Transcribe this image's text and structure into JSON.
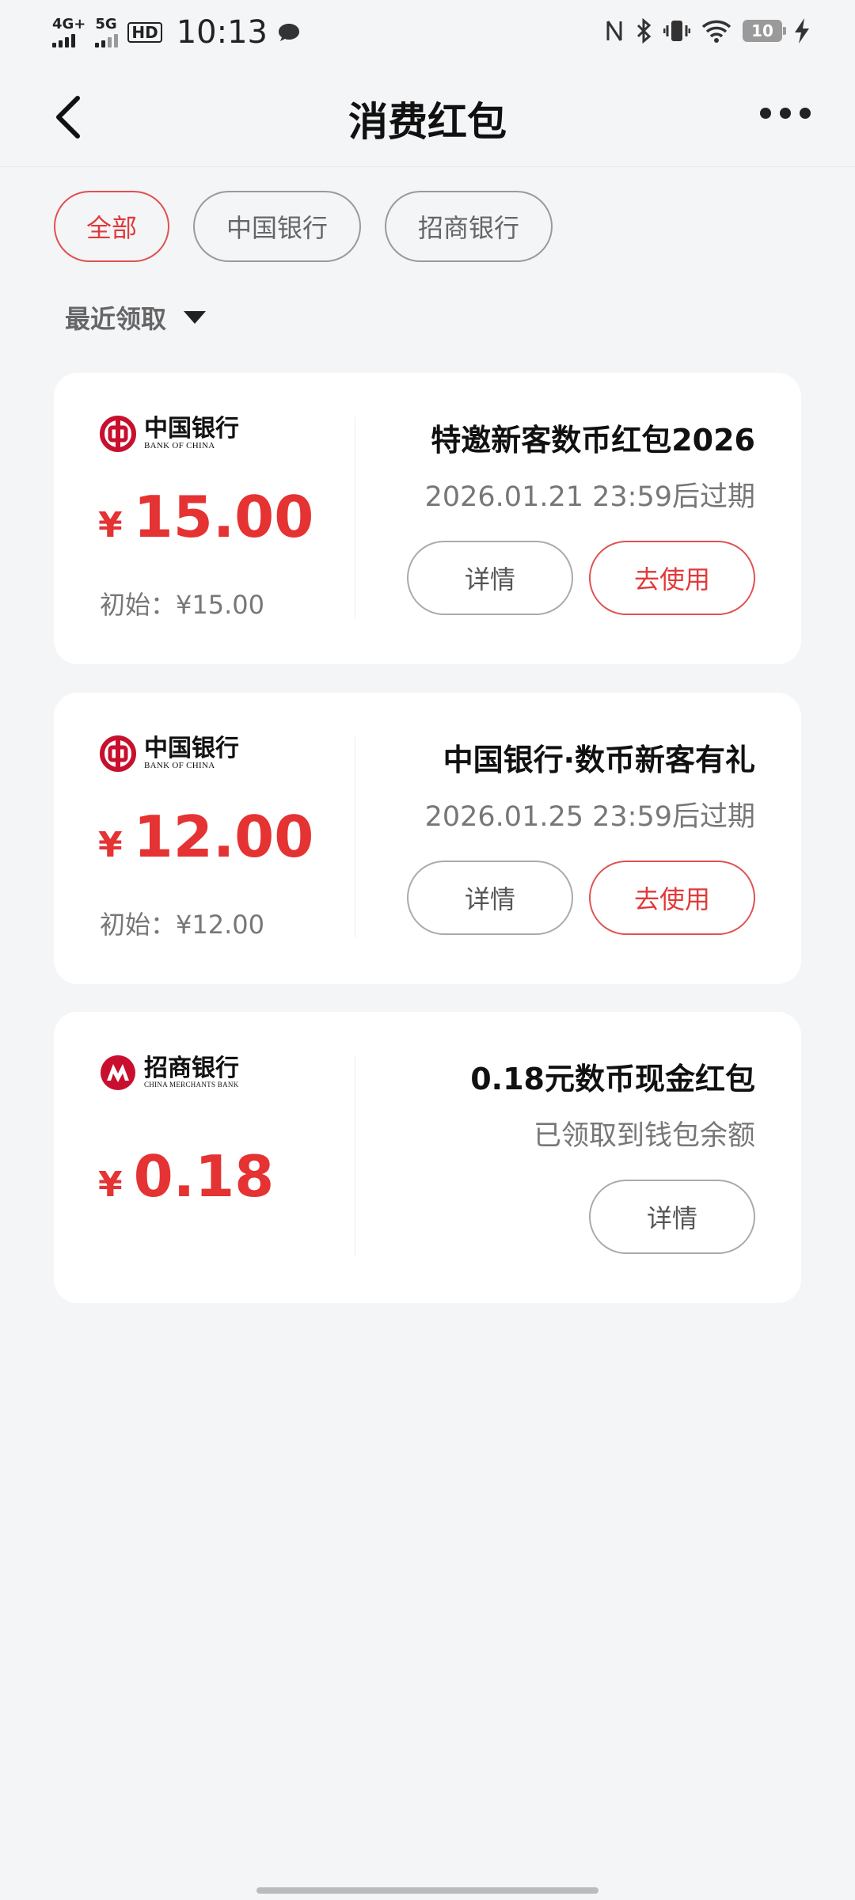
{
  "status_bar": {
    "net1": "4G+",
    "net2": "5G",
    "hd": "HD",
    "time": "10:13",
    "battery": "10",
    "icons": [
      "message-icon",
      "nfc-icon",
      "bluetooth-icon",
      "vibrate-icon",
      "wifi-icon",
      "battery-icon",
      "charging-icon"
    ]
  },
  "nav": {
    "title": "消费红包"
  },
  "filters": [
    {
      "label": "全部",
      "active": true
    },
    {
      "label": "中国银行",
      "active": false
    },
    {
      "label": "招商银行",
      "active": false
    }
  ],
  "sort": {
    "label": "最近领取"
  },
  "cards": [
    {
      "bank_cn": "中国银行",
      "bank_en": "BANK OF CHINA",
      "currency": "¥",
      "amount": "15.00",
      "initial": "初始：¥15.00",
      "title": "特邀新客数币红包2026",
      "subtitle": "2026.01.21 23:59后过期",
      "detail_label": "详情",
      "use_label": "去使用"
    },
    {
      "bank_cn": "中国银行",
      "bank_en": "BANK OF CHINA",
      "currency": "¥",
      "amount": "12.00",
      "initial": "初始：¥12.00",
      "title": "中国银行·数币新客有礼",
      "subtitle": "2026.01.25 23:59后过期",
      "detail_label": "详情",
      "use_label": "去使用"
    },
    {
      "bank_cn": "招商银行",
      "bank_en": "CHINA MERCHANTS BANK",
      "currency": "¥",
      "amount": "0.18",
      "title": "0.18元数币现金红包",
      "subtitle": "已领取到钱包余额",
      "detail_label": "详情"
    }
  ],
  "colors": {
    "accent": "#e53232",
    "background": "#f4f5f7",
    "card": "#ffffff"
  }
}
